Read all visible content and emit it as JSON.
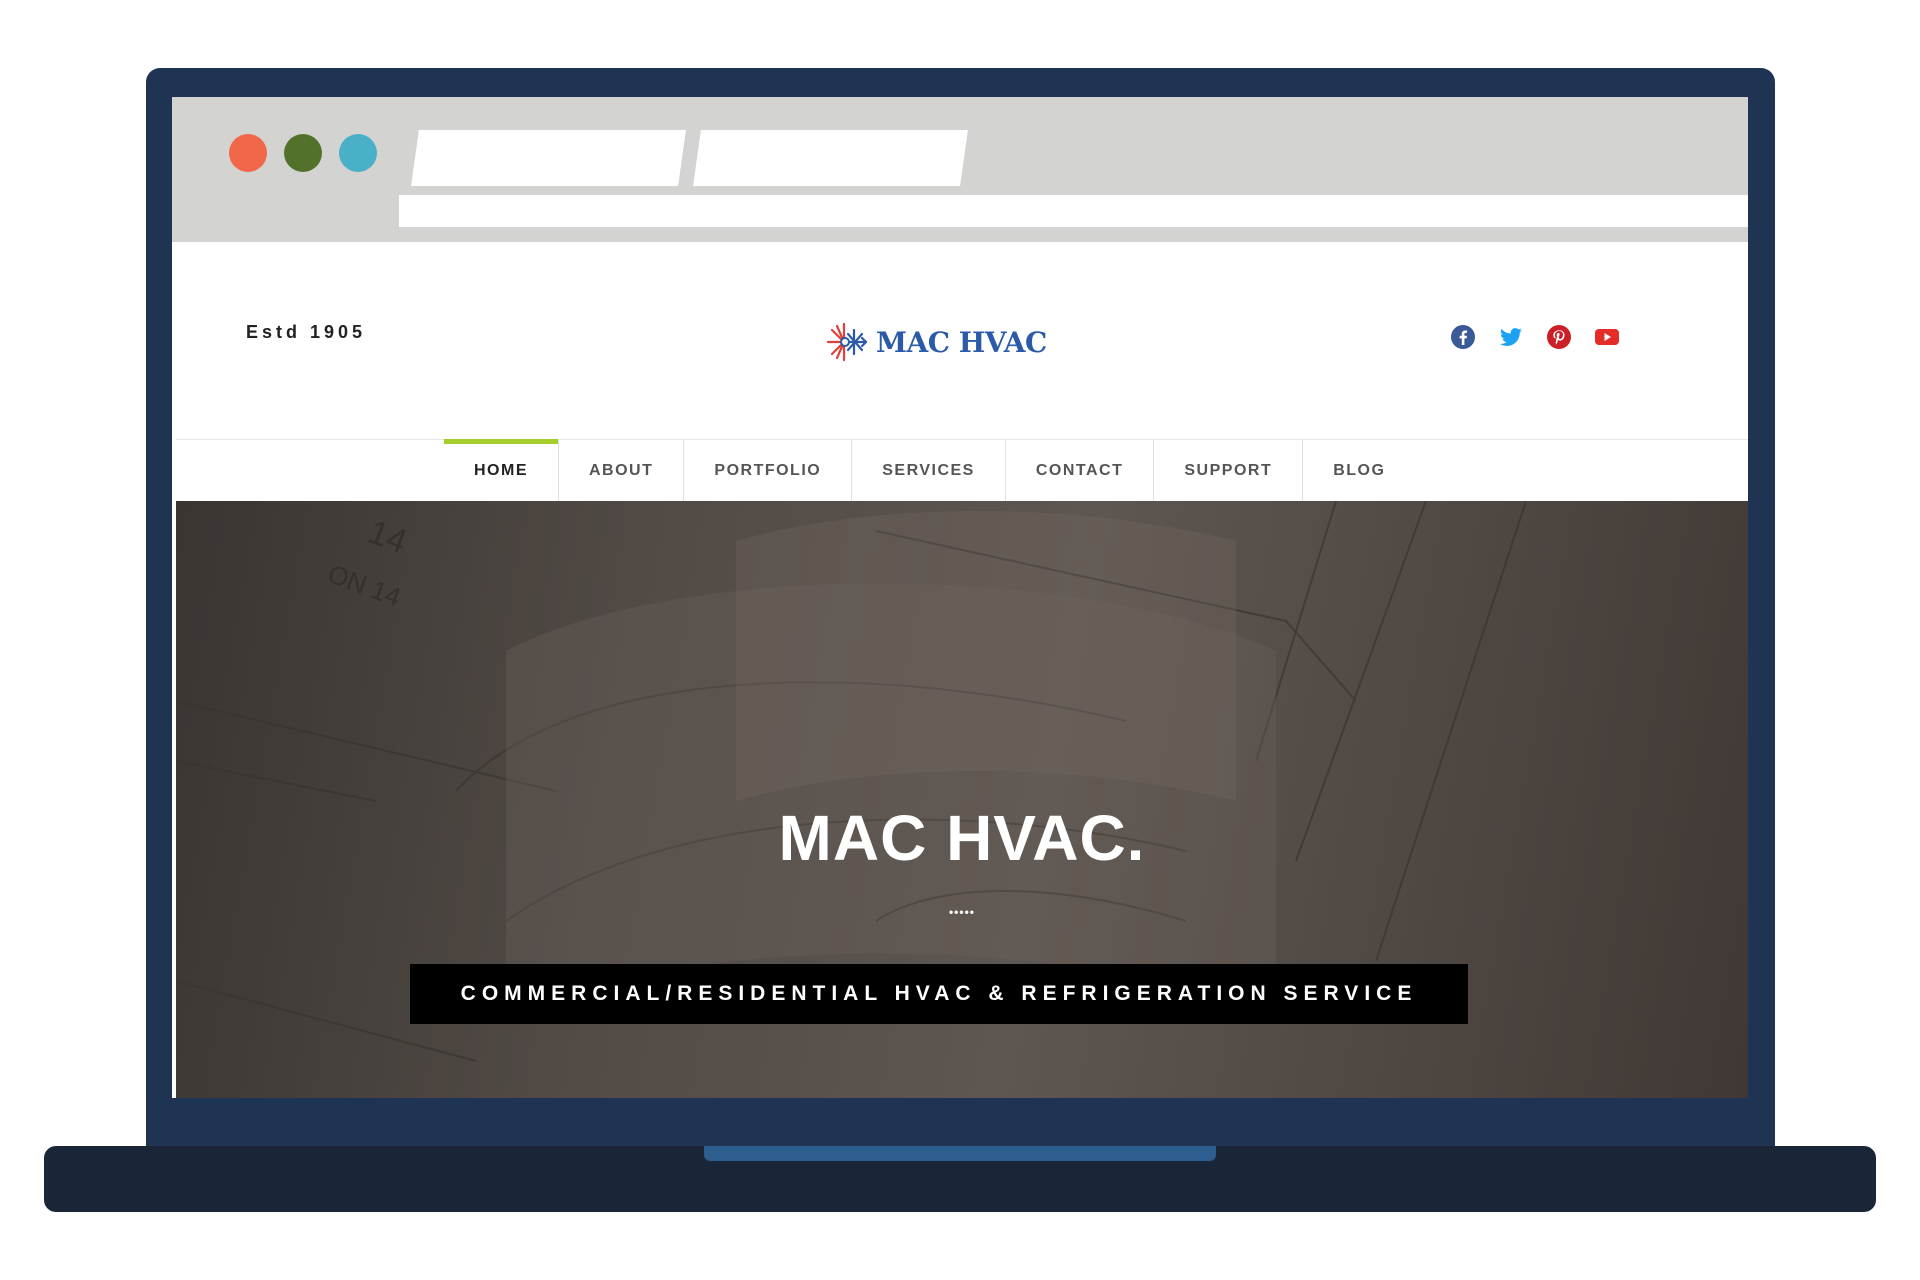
{
  "header": {
    "estd": "Estd 1905",
    "logo_text": "MAC HVAC"
  },
  "social_icons": [
    "facebook-icon",
    "twitter-icon",
    "pinterest-icon",
    "youtube-icon"
  ],
  "nav": {
    "items": [
      {
        "label": "HOME",
        "active": true
      },
      {
        "label": "ABOUT"
      },
      {
        "label": "PORTFOLIO"
      },
      {
        "label": "SERVICES"
      },
      {
        "label": "CONTACT"
      },
      {
        "label": "SUPPORT"
      },
      {
        "label": "BLOG"
      }
    ]
  },
  "hero": {
    "title": "MAC HVAC.",
    "divider": "•••••",
    "subtitle": "COMMERCIAL/RESIDENTIAL HVAC & REFRIGERATION SERVICE"
  },
  "colors": {
    "accent": "#a5cd2b",
    "logo_blue": "#2b5aa8",
    "frame": "#1f3453"
  }
}
